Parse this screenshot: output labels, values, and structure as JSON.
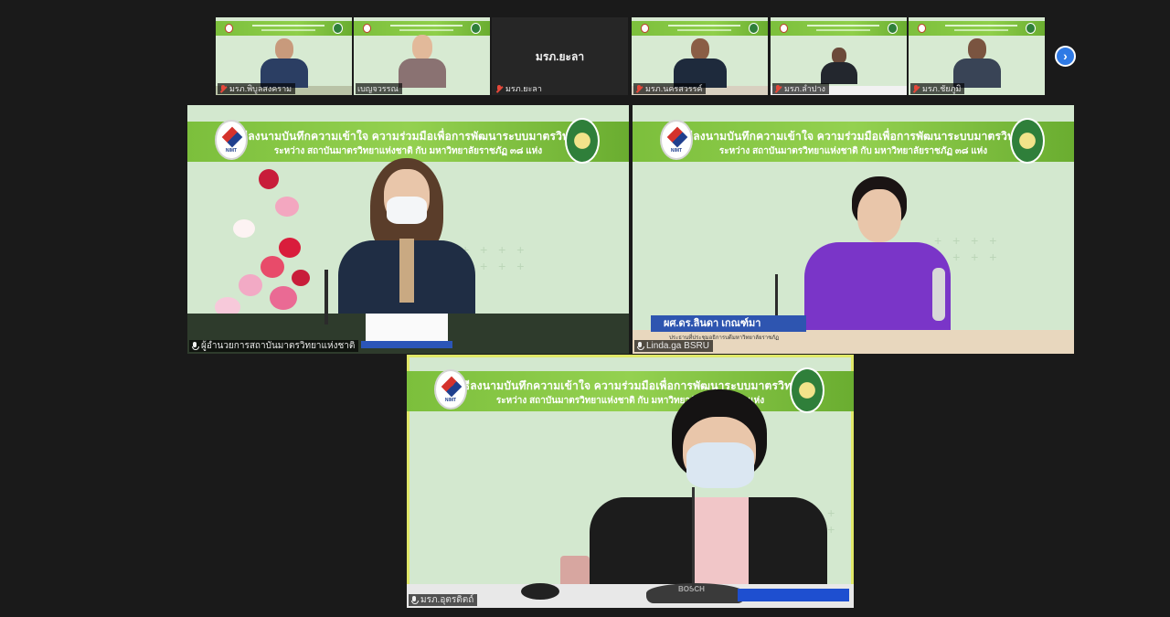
{
  "strip": {
    "tiles": [
      {
        "name": "มรภ.พิบูลสงคราม",
        "muted": true,
        "blank": false,
        "suit": "#2b3e63",
        "hair": "#1f1f1f"
      },
      {
        "name": "เบญจวรรณ",
        "muted": false,
        "blank": false,
        "suit": "#6b5a5a",
        "hair": "#3a2418"
      },
      {
        "name": "มรภ.ยะลา",
        "muted": true,
        "blank": true,
        "display": "มรภ.ยะลา"
      },
      {
        "name": "มรภ.นครสวรรค์",
        "muted": true,
        "blank": false,
        "suit": "#1e2a3c",
        "hair": "#111"
      },
      {
        "name": "มรภ.ลำปาง",
        "muted": true,
        "blank": false,
        "suit": "#23272e",
        "hair": "#222"
      },
      {
        "name": "มรภ.ชัยภูมิ",
        "muted": true,
        "blank": false,
        "suit": "#394456",
        "hair": "#2a2a2a"
      }
    ]
  },
  "next_icon": "›",
  "banner": {
    "line1": "พิธีลงนามบันทึกความเข้าใจ ความร่วมมือเพื่อการพัฒนาระบบมาตรวิทยา",
    "line2": "ระหว่าง สถาบันมาตรวิทยาแห่งชาติ กับ มหาวิทยาลัยราชภัฏ ๓๘ แห่ง",
    "logo_text": "NIMT"
  },
  "main_tiles": {
    "left": {
      "name": "ผู้อำนวยการสถาบันมาตรวิทยาแห่งชาติ"
    },
    "right": {
      "name": "Linda.ga BSRU",
      "nameplate": "ผศ.ดร.ลินดา เกณฑ์มา",
      "nameplate_sub": "ประธานที่ประชุมอธิการบดีมหาวิทยาลัยราชภัฏ"
    },
    "bottom": {
      "name": "มรภ.อุตรดิตถ์",
      "mic_brand": "BOSCH"
    }
  },
  "colors": {
    "banner_green": "#7cbf3c",
    "active_speaker_border": "#e0e868",
    "muted_red": "#e5483a",
    "nav_button_blue": "#2f7ae5"
  },
  "icons": {
    "muted": "mic-muted-icon",
    "unmuted": "mic-icon",
    "next": "chevron-right-icon"
  }
}
